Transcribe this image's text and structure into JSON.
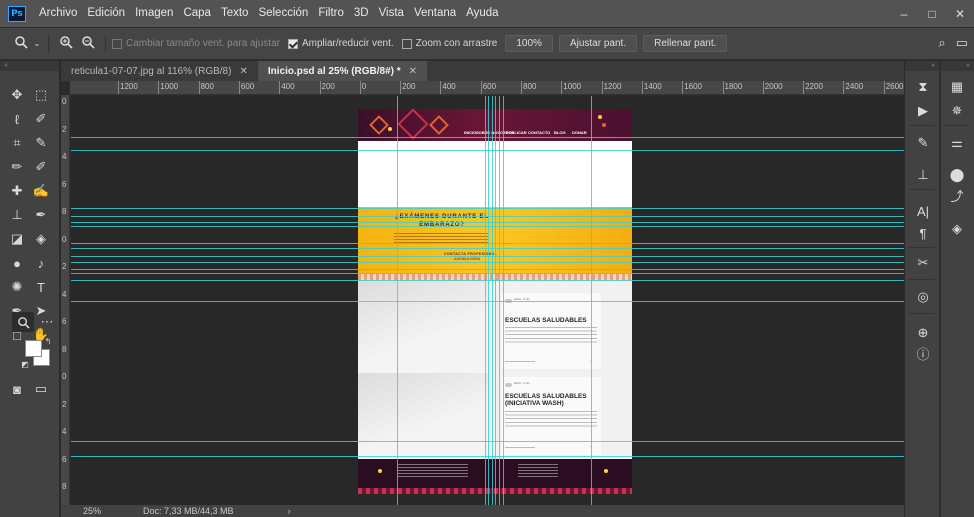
{
  "app": {
    "logo": "Ps"
  },
  "menu": [
    "Archivo",
    "Edición",
    "Imagen",
    "Capa",
    "Texto",
    "Selección",
    "Filtro",
    "3D",
    "Vista",
    "Ventana",
    "Ayuda"
  ],
  "window_controls": {
    "minimize": "–",
    "maximize": "□",
    "close": "✕"
  },
  "options_bar": {
    "resize_windows": "Cambiar tamaño vent. para ajustar",
    "zoom_all_windows": "Ampliar/reducir vent.",
    "scrubby_zoom": "Zoom con arrastre",
    "zoom_percent": "100%",
    "fit_screen": "Ajustar pant.",
    "fill_screen": "Rellenar pant."
  },
  "tabs": [
    {
      "label": "reticula1-07-07.jpg al 116% (RGB/8)",
      "close": "✕",
      "active": false
    },
    {
      "label": "Inicio.psd al 25% (RGB/8#) *",
      "close": "✕",
      "active": true
    }
  ],
  "ruler_h": [
    "1200",
    "1000",
    "800",
    "600",
    "400",
    "200",
    "0",
    "200",
    "400",
    "600",
    "800",
    "1000",
    "1200",
    "1400",
    "1600",
    "1800",
    "2000",
    "2200",
    "2400",
    "2600"
  ],
  "ruler_v": [
    "0",
    "2",
    "4",
    "6",
    "8",
    "0",
    "2",
    "4",
    "6",
    "8",
    "0",
    "2",
    "4",
    "6",
    "8"
  ],
  "document": {
    "nav": [
      "INICIO",
      "SOBRE NOSOTROS",
      "PUBLICAR",
      "CONTACTO",
      "BLOG",
      "DONAR"
    ],
    "banner_title": "¿EXÁMENES DURANTE EL EMBARAZO?",
    "banner_cta": "CONTACTA PROFESIONAL",
    "banner_cta2": "AGENDA HORA",
    "card1": {
      "title": "ESCUELAS SALUDABLES",
      "meta": "Admin · 2 min"
    },
    "card2": {
      "title": "ESCUELAS SALUDABLES (INICIATIVA WASH)",
      "meta": "Admin · 2 min"
    }
  },
  "status": {
    "zoom": "25%",
    "doc": "Doc: 7,33 MB/44,3 MB",
    "arrow": "›"
  },
  "colors": {
    "guide": "#38d1d1",
    "banner": "#fbc623",
    "header": "#6b1637",
    "accent": "#31a8ff"
  }
}
